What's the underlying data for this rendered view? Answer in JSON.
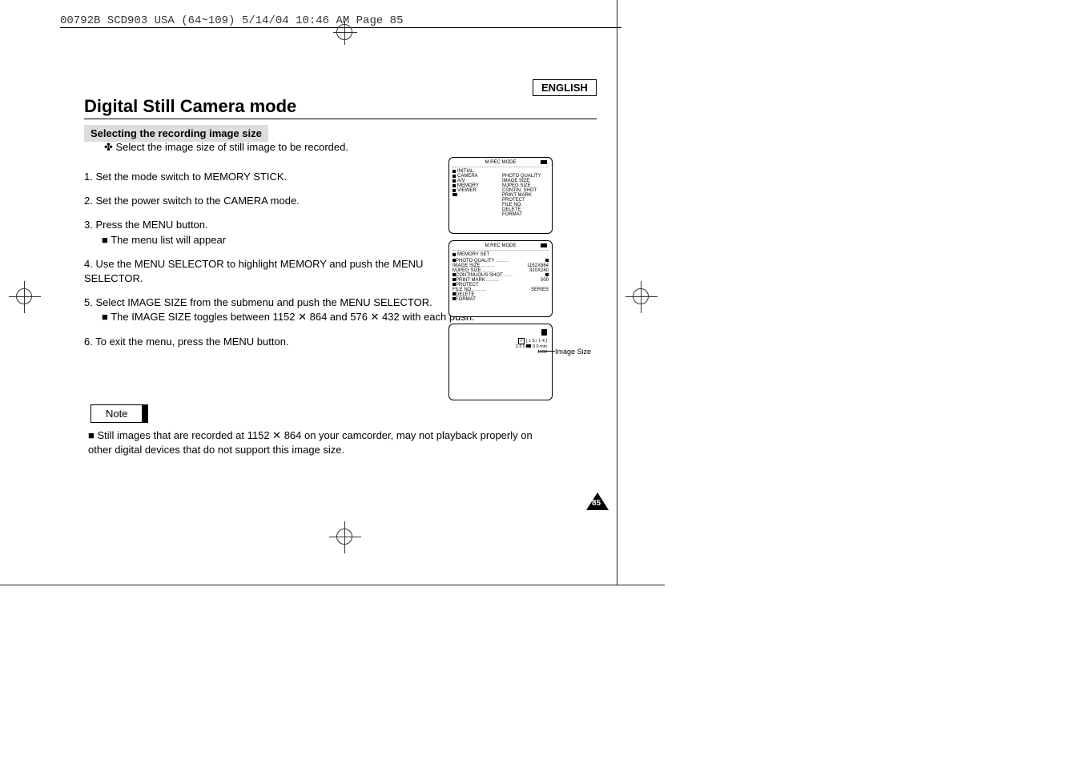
{
  "header": {
    "tag": "00792B SCD903 USA (64~109)  5/14/04 10:46 AM  Page 85",
    "language": "ENGLISH"
  },
  "title": "Digital Still Camera mode",
  "subtitle": "Selecting the recording image size",
  "intro": "✤  Select  the image size of still image to be recorded.",
  "steps": [
    "1.  Set the mode switch to MEMORY STICK.",
    "2.  Set the power switch to the CAMERA mode.",
    "3.  Press the MENU button.",
    "4.  Use the MENU SELECTOR to highlight MEMORY and push the MENU SELECTOR.",
    "5.  Select IMAGE SIZE from the submenu and push the MENU SELECTOR.",
    "6.  To exit the menu, press the MENU button."
  ],
  "substeps": {
    "s3": "The menu list will appear",
    "s5": "The IMAGE SIZE toggles between 1152 ✕ 864 and 576 ✕ 432 with each push."
  },
  "note_label": "Note",
  "note_text": "Still images that are recorded at 1152 ✕ 864 on your camcorder, may not playback properly on other digital devices that do not support this image size.",
  "page_number": "85",
  "lcd1": {
    "title": "M.REC MODE",
    "left_col": [
      "INITIAL",
      "CAMERA",
      "A/V",
      "MEMORY",
      "VIEWER"
    ],
    "right_col": [
      "PHOTO QUALITY",
      "IMAGE SIZE",
      "MJPEG SIZE",
      "CONTIN. SHOT",
      "PRINT MARK",
      "PROTECT",
      "FILE NO.",
      "DELETE",
      "FORMAT"
    ]
  },
  "lcd2": {
    "title": "M.REC  MODE",
    "subtitle": "MEMORY SET",
    "items": [
      {
        "label": "PHOTO QUALITY",
        "value": ""
      },
      {
        "label": "IMAGE SIZE",
        "value": "1152X864"
      },
      {
        "label": "MJPEG SIZE",
        "value": "320X240"
      },
      {
        "label": "CONTINUOUS SHOT",
        "value": ""
      },
      {
        "label": "PRINT MARK",
        "value": "000"
      },
      {
        "label": "PROTECT",
        "value": ""
      },
      {
        "label": "FILE NO.",
        "value": "SERIES"
      },
      {
        "label": "DELETE",
        "value": ""
      },
      {
        "label": "FORMAT",
        "value": ""
      }
    ]
  },
  "lcd3": {
    "counter": "[ 1 5 / 1 4 ]",
    "rec_time": "0 0 min",
    "size_label_320": "3 2 0",
    "size_label_1152": "1152"
  },
  "callout": "Image Size"
}
